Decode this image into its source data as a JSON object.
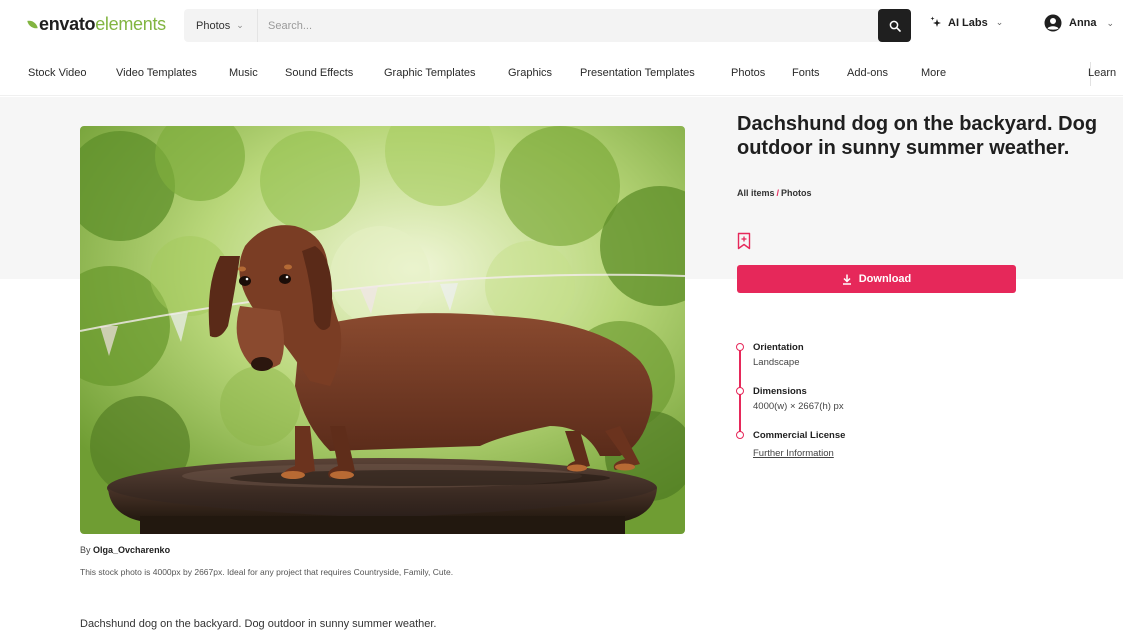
{
  "header": {
    "logo_bold": "envato",
    "logo_light": "elements",
    "search_category": "Photos",
    "search_placeholder": "Search...",
    "ai_labs": "AI Labs",
    "user_name": "Anna"
  },
  "nav": {
    "items": [
      "Stock Video",
      "Video Templates",
      "Music",
      "Sound Effects",
      "Graphic Templates",
      "Graphics",
      "Presentation Templates",
      "Photos",
      "Fonts",
      "Add-ons",
      "More"
    ],
    "learn": "Learn"
  },
  "item": {
    "title": "Dachshund dog on the backyard. Dog outdoor in sunny summer weather.",
    "breadcrumb": [
      "All items",
      "Photos"
    ],
    "download_label": "Download",
    "byline_prefix": "By",
    "author": "Olga_Ovcharenko",
    "summary": "This stock photo is 4000px by 2667px. Ideal for any project that requires Countryside, Family, Cute.",
    "description": "Dachshund dog on the backyard. Dog outdoor in sunny summer weather."
  },
  "details": {
    "orientation_label": "Orientation",
    "orientation_value": "Landscape",
    "dimensions_label": "Dimensions",
    "dimensions_value": "4000(w) × 2667(h) px",
    "license_label": "Commercial License",
    "license_link": "Further Information"
  },
  "colors": {
    "accent": "#e6285a",
    "brand_green": "#82b541",
    "dark": "#1f1f1f"
  }
}
